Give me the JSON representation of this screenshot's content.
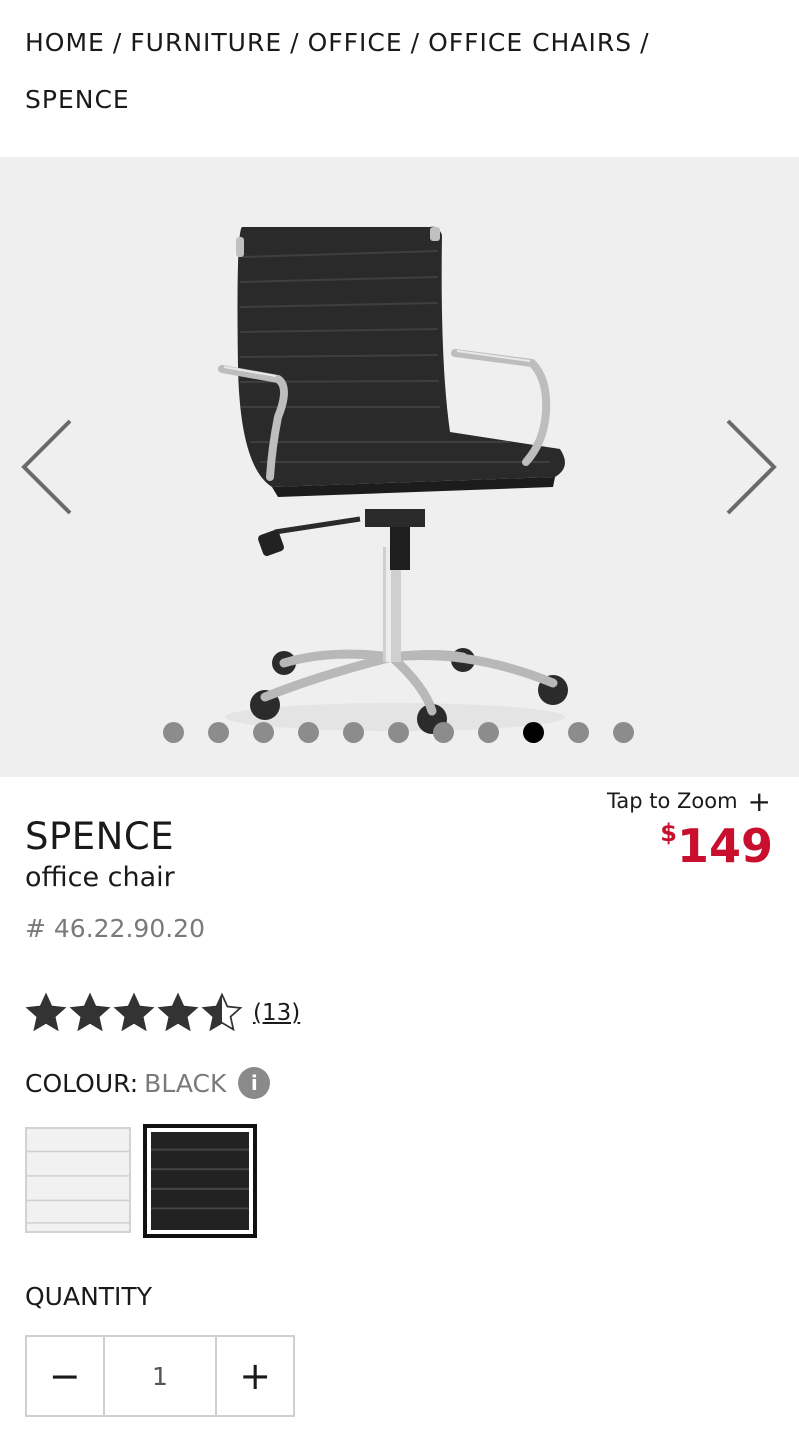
{
  "breadcrumb": {
    "items": [
      "HOME",
      "FURNITURE",
      "OFFICE",
      "OFFICE CHAIRS",
      "SPENCE"
    ],
    "separator": "/"
  },
  "gallery": {
    "prev_icon": "chevron-left-icon",
    "next_icon": "chevron-right-icon",
    "image_count": 11,
    "active_index": 8,
    "zoom_label": "Tap to Zoom",
    "zoom_symbol": "+"
  },
  "product": {
    "name": "SPENCE",
    "subtitle": "office chair",
    "sku": "# 46.22.90.20",
    "price_currency": "$",
    "price_value": "149",
    "price_color": "#c8102e",
    "rating": 4.5,
    "reviews": "(13)"
  },
  "colour": {
    "label": "COLOUR:",
    "selected": "BLACK",
    "info_icon": "info-icon",
    "swatches": [
      {
        "name": "white",
        "color": "#f1f1f1"
      },
      {
        "name": "black",
        "color": "#222222"
      }
    ]
  },
  "quantity": {
    "label": "QUANTITY",
    "value": "1",
    "minus": "−",
    "plus": "+"
  }
}
